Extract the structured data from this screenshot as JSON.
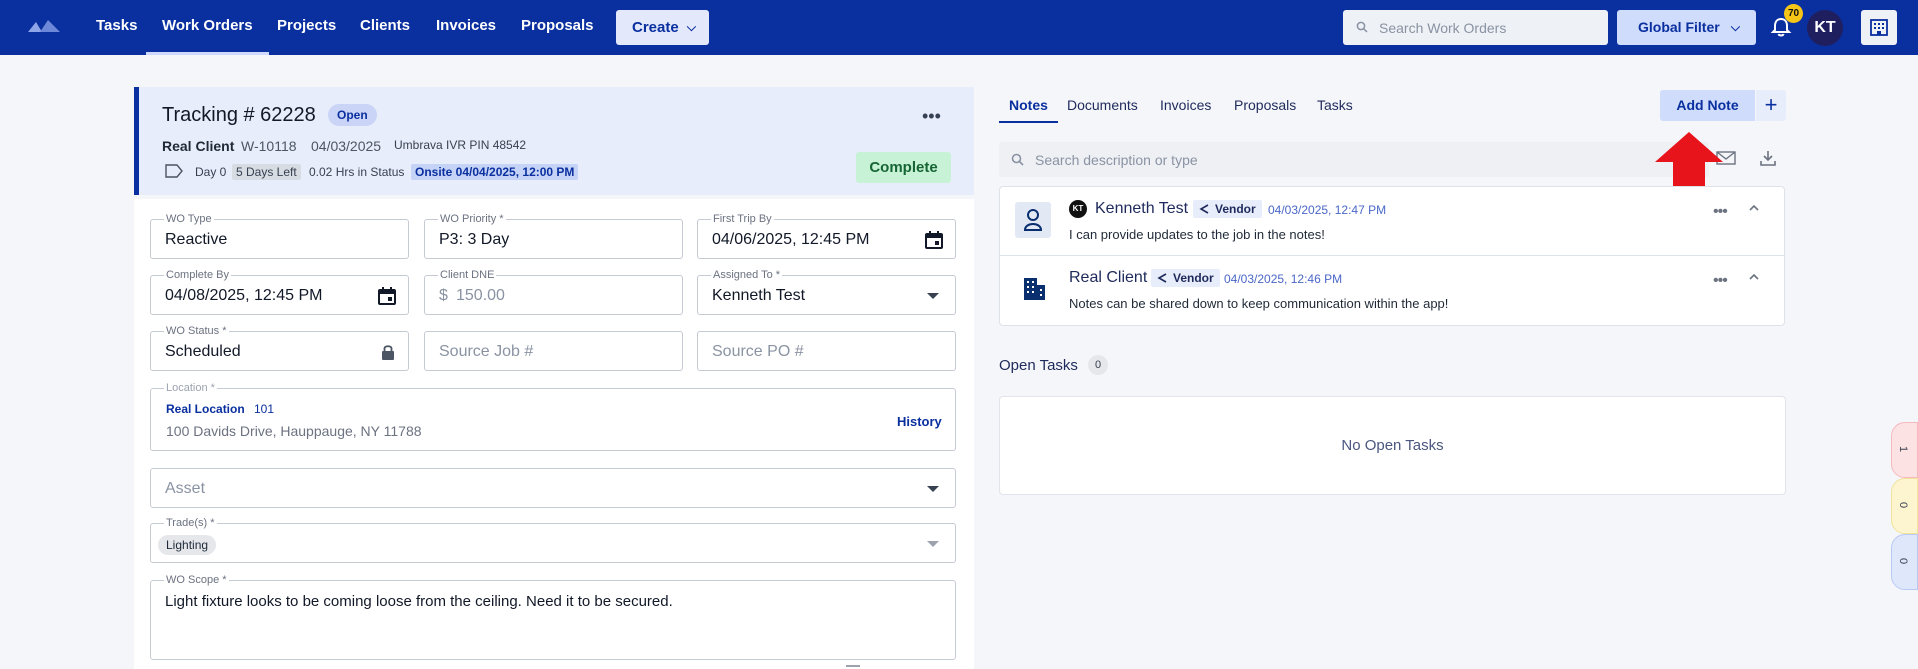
{
  "nav": {
    "items": [
      "Tasks",
      "Work Orders",
      "Projects",
      "Clients",
      "Invoices",
      "Proposals"
    ],
    "active": "Work Orders",
    "create_label": "Create",
    "search_placeholder": "Search Work Orders",
    "global_filter_label": "Global Filter",
    "notification_count": "70",
    "user_initials": "KT"
  },
  "wo": {
    "title": "Tracking # 62228",
    "status_badge": "Open",
    "client": "Real Client",
    "wo_number": "W-10118",
    "date": "04/03/2025",
    "ivr": "Umbrava IVR PIN 48542",
    "day": "Day 0",
    "days_left": "5 Days Left",
    "hrs_in_status": "0.02 Hrs in Status",
    "onsite": "Onsite 04/04/2025, 12:00 PM",
    "complete_label": "Complete"
  },
  "form": {
    "wo_type": {
      "label": "WO Type",
      "value": "Reactive"
    },
    "wo_priority": {
      "label": "WO Priority *",
      "value": "P3: 3 Day"
    },
    "first_trip": {
      "label": "First Trip By",
      "value": "04/06/2025, 12:45 PM"
    },
    "complete_by": {
      "label": "Complete By",
      "value": "04/08/2025, 12:45 PM"
    },
    "client_dne": {
      "label": "Client DNE",
      "prefix": "$",
      "placeholder": "150.00"
    },
    "assigned_to": {
      "label": "Assigned To *",
      "value": "Kenneth Test"
    },
    "wo_status": {
      "label": "WO Status *",
      "value": "Scheduled"
    },
    "source_job": {
      "placeholder": "Source Job #"
    },
    "source_po": {
      "placeholder": "Source PO #"
    },
    "location": {
      "label": "Location *",
      "name": "Real Location",
      "number": "101",
      "address": "100 Davids Drive, Hauppauge, NY 11788",
      "history_label": "History"
    },
    "asset": {
      "placeholder": "Asset"
    },
    "trades": {
      "label": "Trade(s) *",
      "chips": [
        "Lighting"
      ]
    },
    "scope": {
      "label": "WO Scope *",
      "value": "Light fixture looks to be coming loose from the ceiling. Need it to be  secured."
    }
  },
  "right": {
    "tabs": [
      "Notes",
      "Documents",
      "Invoices",
      "Proposals",
      "Tasks"
    ],
    "active_tab": "Notes",
    "add_note_label": "Add Note",
    "plus_label": "+",
    "search_placeholder": "Search description or type",
    "notes": [
      {
        "author": "Kenneth Test",
        "initials": "KT",
        "role": "Vendor",
        "date": "04/03/2025, 12:47 PM",
        "text": "I can provide updates to the job in the notes!"
      },
      {
        "author": "Real Client",
        "role": "Vendor",
        "date": "04/03/2025, 12:46 PM",
        "text": "Notes can be shared down to keep communication within the app!"
      }
    ],
    "open_tasks_label": "Open Tasks",
    "open_tasks_count": "0",
    "no_tasks_text": "No Open Tasks"
  },
  "edge_counts": [
    "1",
    "0",
    "0"
  ],
  "colors": {
    "nav_bg": "#0a2f9f",
    "accent": "#0a2f9f",
    "complete_bg": "#c8f2d6",
    "arrow": "#e8141b"
  }
}
